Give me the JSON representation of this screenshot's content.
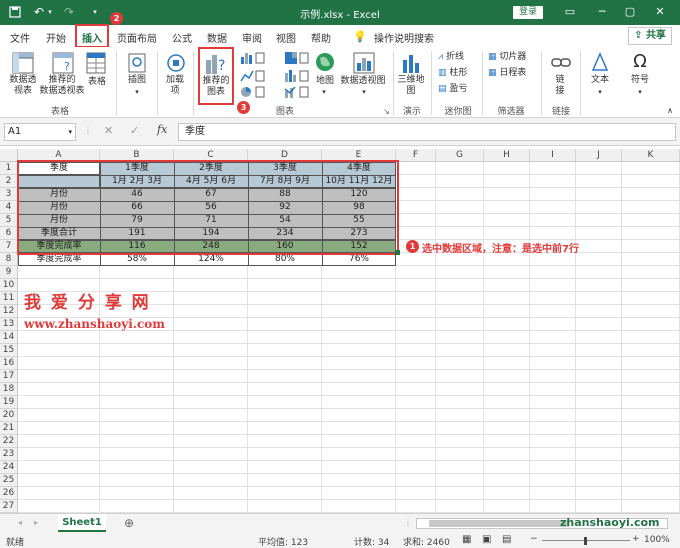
{
  "titlebar": {
    "file_title": "示例.xlsx - Excel",
    "login_label": "登录",
    "minimize": "─",
    "restore": "▢",
    "close": "✕",
    "ribbon_display": "▭"
  },
  "tabs": [
    {
      "label": "文件"
    },
    {
      "label": "开始"
    },
    {
      "label": "插入"
    },
    {
      "label": "页面布局"
    },
    {
      "label": "公式"
    },
    {
      "label": "数据"
    },
    {
      "label": "审阅"
    },
    {
      "label": "视图"
    },
    {
      "label": "帮助"
    },
    {
      "label": "操作说明搜索"
    }
  ],
  "share_label": "共享",
  "ribbon": {
    "pivot_table": "数据透\n视表",
    "recommended_pivot": "推荐的\n数据透视表",
    "table": "表格",
    "illustrations": "插图",
    "addins": "加载\n项",
    "recommended_charts": "推荐的\n图表",
    "maps": "地图",
    "pivot_chart": "数据透视图",
    "map3d": "三维地\n图",
    "sparkline_line": "折线",
    "sparkline_column": "柱形",
    "sparkline_winloss": "盈亏",
    "slicer": "切片器",
    "timeline": "日程表",
    "link": "链\n接",
    "text": "文本",
    "symbols": "符号",
    "groups": {
      "tables": "表格",
      "charts": "图表",
      "tours": "演示",
      "sparklines": "迷你图",
      "filters": "筛选器",
      "links": "链接"
    }
  },
  "badges": {
    "one": "1",
    "two": "2",
    "three": "3"
  },
  "formula_bar": {
    "name_box": "A1",
    "content": "季度"
  },
  "columns": [
    "A",
    "B",
    "C",
    "D",
    "E",
    "F",
    "G",
    "H",
    "I",
    "J",
    "K"
  ],
  "rows": [
    "1",
    "2",
    "3",
    "4",
    "5",
    "6",
    "7",
    "8",
    "9",
    "10",
    "11",
    "12",
    "13",
    "14",
    "15",
    "16",
    "17",
    "18",
    "19",
    "20",
    "21",
    "22",
    "23",
    "24",
    "25",
    "26",
    "27"
  ],
  "table": {
    "header1": [
      "季度",
      "1季度",
      "2季度",
      "3季度",
      "4季度"
    ],
    "header2": [
      "",
      "1月 2月 3月",
      "4月 5月 6月",
      "7月 8月 9月",
      "10月 11月 12月"
    ],
    "data": [
      [
        "月份",
        "46",
        "67",
        "88",
        "120"
      ],
      [
        "月份",
        "66",
        "56",
        "92",
        "98"
      ],
      [
        "月份",
        "79",
        "71",
        "54",
        "55"
      ],
      [
        "季度合计",
        "191",
        "194",
        "234",
        "273"
      ],
      [
        "季度完成率",
        "116",
        "248",
        "160",
        "152"
      ],
      [
        "季度完成率",
        "58%",
        "124%",
        "80%",
        "76%"
      ]
    ]
  },
  "annotation": "选中数据区域，注意：是选中前7行",
  "watermark": {
    "name": "我 爱 分 享 网",
    "url": "www.zhanshaoyi.com",
    "corner": "zhanshaoyi.com"
  },
  "sheet_tab": "Sheet1",
  "status": {
    "ready": "就绪",
    "average": "平均值: 123",
    "count": "计数: 34",
    "sum": "求和: 2460",
    "zoom": "100%"
  }
}
